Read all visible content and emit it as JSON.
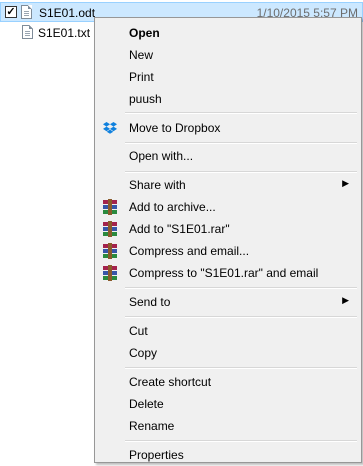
{
  "files": [
    {
      "name": "S1E01.odt",
      "date": "1/10/2015 5:57 PM",
      "checked": "✓"
    },
    {
      "name": "S1E01.txt"
    }
  ],
  "menu": {
    "open": "Open",
    "new": "New",
    "print": "Print",
    "puush": "puush",
    "move_to_dropbox": "Move to Dropbox",
    "open_with": "Open with...",
    "share_with": "Share with",
    "add_to_archive": "Add to archive...",
    "add_to_rar": "Add to \"S1E01.rar\"",
    "compress_and_email": "Compress and email...",
    "compress_to_rar_email": "Compress to \"S1E01.rar\" and email",
    "send_to": "Send to",
    "cut": "Cut",
    "copy": "Copy",
    "create_shortcut": "Create shortcut",
    "delete": "Delete",
    "rename": "Rename",
    "properties": "Properties",
    "submenu_arrow": "▶"
  },
  "icons": {
    "dropbox": "dropbox-icon",
    "winrar": "winrar-icon"
  },
  "colors": {
    "selection_bg": "#cce8ff",
    "selection_border": "#99d1ff",
    "menu_bg": "#f0f0f0",
    "dropbox_blue": "#1081de"
  }
}
